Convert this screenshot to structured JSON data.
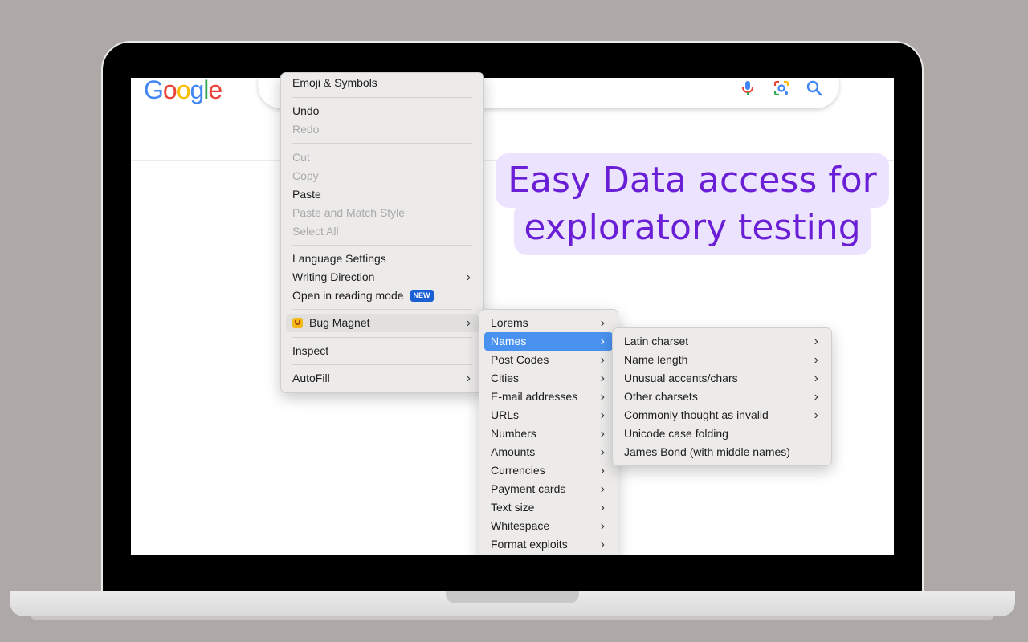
{
  "google": {
    "logo_text": "Google"
  },
  "search_icons": [
    "microphone-icon",
    "lens-camera-icon",
    "search-icon"
  ],
  "headline": {
    "line1": "Easy Data access for",
    "line2": "exploratory testing",
    "color": "#6a1fd6",
    "highlight": "#ece4ff"
  },
  "context_menu": {
    "items": [
      {
        "label": "Emoji & Symbols",
        "enabled": true
      },
      {
        "label": "Undo",
        "enabled": true
      },
      {
        "label": "Redo",
        "enabled": false
      },
      {
        "label": "Cut",
        "enabled": false
      },
      {
        "label": "Copy",
        "enabled": false
      },
      {
        "label": "Paste",
        "enabled": true
      },
      {
        "label": "Paste and Match Style",
        "enabled": false
      },
      {
        "label": "Select All",
        "enabled": false
      },
      {
        "label": "Language Settings",
        "enabled": true
      },
      {
        "label": "Writing Direction",
        "enabled": true,
        "submenu": true
      },
      {
        "label": "Open in reading mode",
        "enabled": true,
        "badge": "NEW"
      },
      {
        "label": "Bug Magnet",
        "enabled": true,
        "submenu": true,
        "icon": "bug-magnet-icon"
      },
      {
        "label": "Inspect",
        "enabled": true
      },
      {
        "label": "AutoFill",
        "enabled": true,
        "submenu": true
      }
    ]
  },
  "bug_magnet_menu": {
    "items": [
      "Lorems",
      "Names",
      "Post Codes",
      "Cities",
      "E-mail addresses",
      "URLs",
      "Numbers",
      "Amounts",
      "Currencies",
      "Payment cards",
      "Text size",
      "Whitespace",
      "Format exploits"
    ],
    "active": "Names"
  },
  "names_menu": {
    "items": [
      {
        "label": "Latin charset",
        "submenu": true
      },
      {
        "label": "Name length",
        "submenu": true
      },
      {
        "label": "Unusual accents/chars",
        "submenu": true
      },
      {
        "label": "Other charsets",
        "submenu": true
      },
      {
        "label": "Commonly thought as invalid",
        "submenu": true
      },
      {
        "label": "Unicode case folding",
        "submenu": false
      },
      {
        "label": "James Bond (with middle names)",
        "submenu": false
      }
    ]
  },
  "colors": {
    "menu_bg": "#ecebea",
    "active_item": "#4a92f0",
    "background": "#aea9a6"
  }
}
